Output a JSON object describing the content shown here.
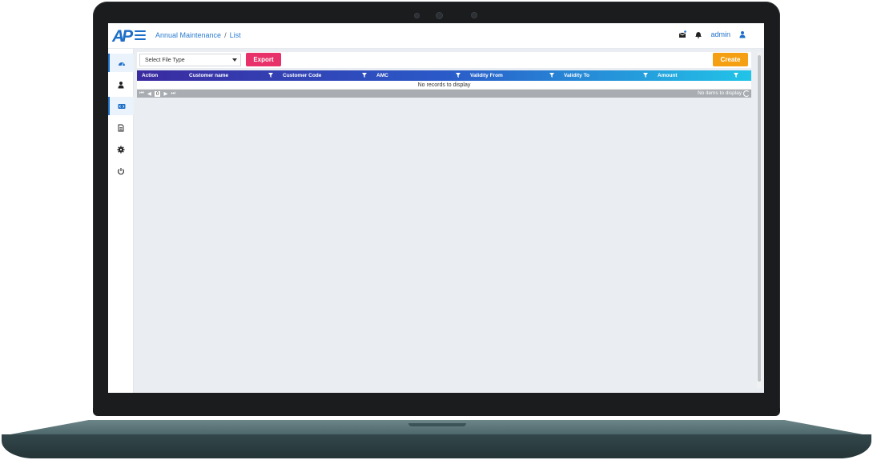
{
  "app": {
    "logo_text": "AP",
    "breadcrumb": {
      "section": "Annual Maintenance",
      "separator": "/",
      "page": "List"
    },
    "user": "admin"
  },
  "toolbar": {
    "file_type_placeholder": "Select File Type",
    "export_label": "Export",
    "create_label": "Create"
  },
  "grid": {
    "columns": [
      "Action",
      "Customer name",
      "Customer Code",
      "AMC",
      "Validity From",
      "Validity To",
      "Amount"
    ],
    "empty_message": "No records to display",
    "pager": {
      "current_page": "0",
      "info": "No items to display"
    }
  },
  "sidebar": {
    "items": [
      "dashboard-icon",
      "user-icon",
      "code-icon",
      "document-icon",
      "gear-icon",
      "power-icon"
    ]
  },
  "colors": {
    "primary": "#1e6fc8",
    "export": "#e8316a",
    "create": "#f5a012",
    "header_gradient_start": "#3a2aa0",
    "header_gradient_end": "#22c4e8"
  }
}
